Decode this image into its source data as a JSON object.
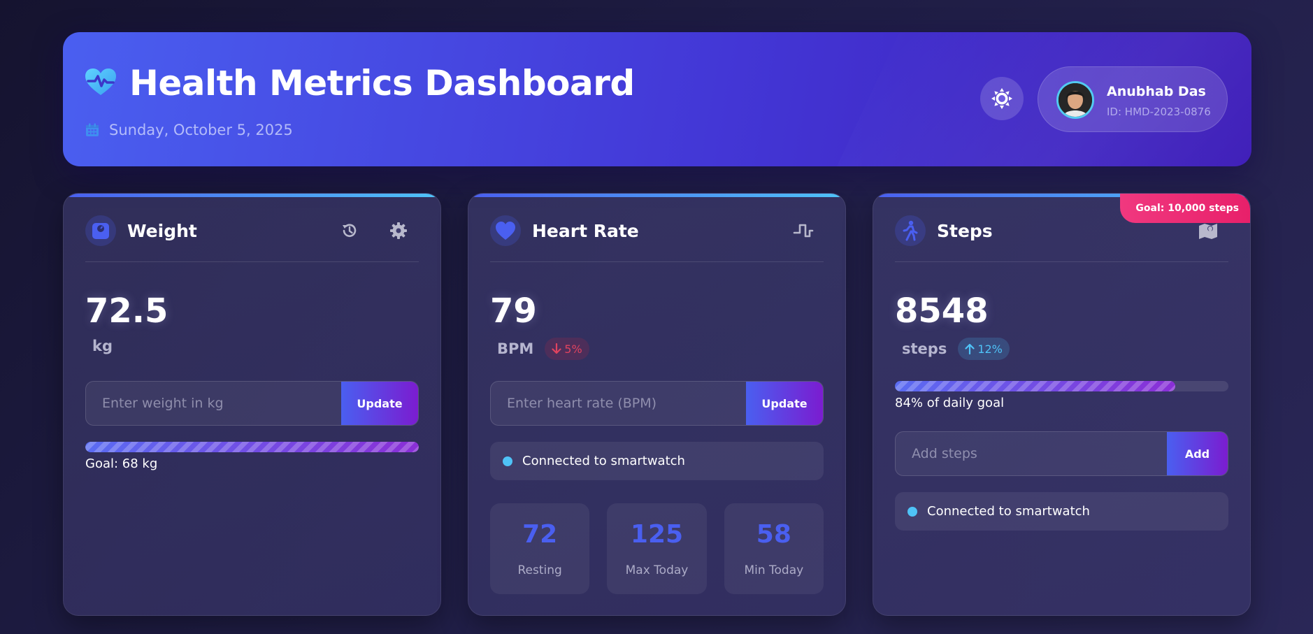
{
  "header": {
    "title": "Health Metrics Dashboard",
    "date": "Sunday, October 5, 2025",
    "logo_icon": "heart-pulse-icon",
    "user": {
      "name": "Anubhab Das",
      "id": "ID: HMD-2023-0876"
    }
  },
  "colors": {
    "accent": "#4a5ff0",
    "accent_light": "#4fc3f7",
    "purple": "#7b1cd0",
    "danger": "#e0435f",
    "ribbon": "#e8206a"
  },
  "weight": {
    "title": "Weight",
    "value": "72.5",
    "unit": "kg",
    "input_placeholder": "Enter weight in kg",
    "button": "Update",
    "progress_fraction": 1.0,
    "goal_text": "Goal: 68 kg",
    "actions": [
      "history-icon",
      "gear-icon"
    ]
  },
  "heart": {
    "title": "Heart Rate",
    "value": "79",
    "unit": "BPM",
    "trend": "5%",
    "trend_direction": "down",
    "input_placeholder": "Enter heart rate (BPM)",
    "button": "Update",
    "connection": "Connected to smartwatch",
    "stats": [
      {
        "value": "72",
        "label": "Resting"
      },
      {
        "value": "125",
        "label": "Max Today"
      },
      {
        "value": "58",
        "label": "Min Today"
      }
    ]
  },
  "steps": {
    "title": "Steps",
    "goal_badge": "Goal: 10,000 steps",
    "value": "8548",
    "unit": "steps",
    "trend": "12%",
    "trend_direction": "up",
    "progress_fraction": 0.84,
    "progress_text": "84% of daily goal",
    "input_placeholder": "Add steps",
    "button": "Add",
    "connection": "Connected to smartwatch"
  }
}
